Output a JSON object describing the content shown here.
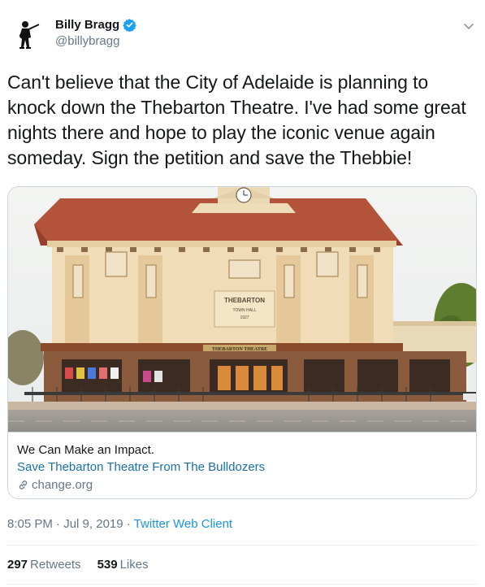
{
  "author": {
    "display_name": "Billy Bragg",
    "handle": "@billybragg",
    "verified": true,
    "avatar_icon": "guitarist-silhouette-icon"
  },
  "tweet": {
    "lines": [
      "Can't believe that the City of Adelaide is planning to",
      "knock down the Thebarton Theatre. I've had some great",
      "nights there and hope to play the iconic venue again",
      "someday. Sign the petition and save the Thebbie!"
    ]
  },
  "card": {
    "image_signage": {
      "building_name": "THEBARTON",
      "sub_name": "TOWN HALL",
      "year": "1927",
      "awning_sign": "THEBARTON THEATRE"
    },
    "description": "We Can Make an Impact.",
    "title": "Save Thebarton Theatre From The Bulldozers",
    "domain": "change.org"
  },
  "meta": {
    "time": "8:05 PM",
    "separator1": " · ",
    "date": "Jul 9, 2019",
    "separator2": " · ",
    "source": "Twitter Web Client"
  },
  "stats": {
    "retweets_count": "297",
    "retweets_label": "Retweets",
    "likes_count": "539",
    "likes_label": "Likes"
  },
  "colors": {
    "link": "#1b95e0",
    "verified": "#1da1f2",
    "muted": "#657786"
  }
}
